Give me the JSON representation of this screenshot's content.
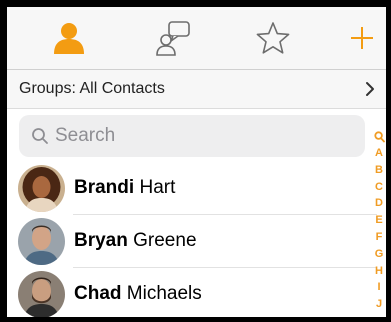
{
  "colors": {
    "accent": "#f39c12",
    "index": "#f09c24"
  },
  "tabs": [
    {
      "icon": "person-icon",
      "active": true
    },
    {
      "icon": "chat-icon",
      "active": false
    },
    {
      "icon": "star-icon",
      "active": false
    },
    {
      "icon": "plus-icon",
      "active": false
    }
  ],
  "groups": {
    "label": "Groups: All Contacts"
  },
  "search": {
    "placeholder": "Search"
  },
  "contacts": [
    {
      "first": "Brandi",
      "last": " Hart"
    },
    {
      "first": "Bryan",
      "last": " Greene"
    },
    {
      "first": "Chad",
      "last": " Michaels"
    }
  ],
  "index": [
    "A",
    "B",
    "C",
    "D",
    "E",
    "F",
    "G",
    "H",
    "I",
    "J"
  ]
}
